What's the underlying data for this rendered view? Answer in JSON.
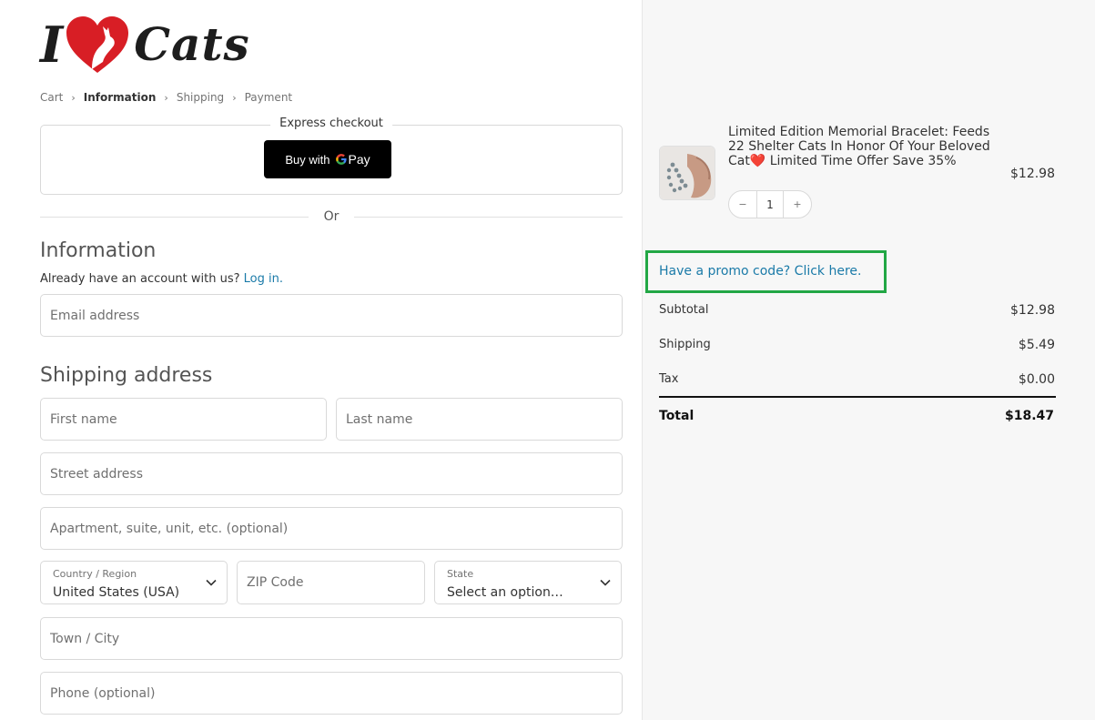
{
  "brand": {
    "logo_prefix": "I",
    "logo_suffix": "Cats",
    "heart_color": "#d81e25"
  },
  "breadcrumb": [
    "Cart",
    "Information",
    "Shipping",
    "Payment"
  ],
  "express": {
    "legend": "Express checkout",
    "gpay_text": "Buy with",
    "gpay_suffix": "Pay",
    "gpay_icon": "google-g-icon"
  },
  "or_text": "Or",
  "information": {
    "heading": "Information",
    "account_prompt": "Already have an account with us?",
    "login_link": "Log in.",
    "email_placeholder": "Email address"
  },
  "shipping_address": {
    "heading": "Shipping address",
    "first_name_placeholder": "First name",
    "last_name_placeholder": "Last name",
    "street_placeholder": "Street address",
    "apartment_placeholder": "Apartment, suite, unit, etc. (optional)",
    "country_label": "Country / Region",
    "country_value": "United States (USA)",
    "zip_placeholder": "ZIP Code",
    "state_label": "State",
    "state_value": "Select an option…",
    "city_placeholder": "Town / City",
    "phone_placeholder": "Phone (optional)"
  },
  "order": {
    "product_title": "Limited Edition Memorial Bracelet: Feeds 22 Shelter Cats In Honor Of Your Beloved Cat",
    "product_title_tail": " Limited Time Offer Save 35%",
    "heart_emoji": "❤️",
    "product_price": "$12.98",
    "quantity": "1",
    "qty_minus": "−",
    "qty_plus": "+",
    "promo_link": "Have a promo code? Click here.",
    "highlight_color": "#22a745",
    "subtotal_label": "Subtotal",
    "subtotal_value": "$12.98",
    "shipping_label": "Shipping",
    "shipping_value": "$5.49",
    "tax_label": "Tax",
    "tax_value": "$0.00",
    "total_label": "Total",
    "total_value": "$18.47"
  },
  "colors": {
    "link": "#1a7aa8",
    "sidebar_bg": "#f7f7f7"
  }
}
